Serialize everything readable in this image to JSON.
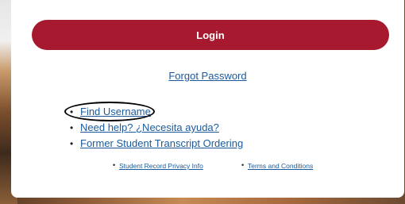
{
  "login": {
    "button_label": "Login"
  },
  "forgot_password": "Forgot Password",
  "links": [
    {
      "label": "Find Username"
    },
    {
      "label": "Need help? ¿Necesita ayuda?"
    },
    {
      "label": "Former Student Transcript Ordering"
    }
  ],
  "footer": {
    "privacy": "Student Record Privacy Info",
    "terms": "Terms and Conditions"
  },
  "colors": {
    "brand": "#a6192e",
    "link": "#1a5a9c",
    "annotation": "#000000"
  },
  "icons": {
    "bullet": "bullet-icon"
  }
}
